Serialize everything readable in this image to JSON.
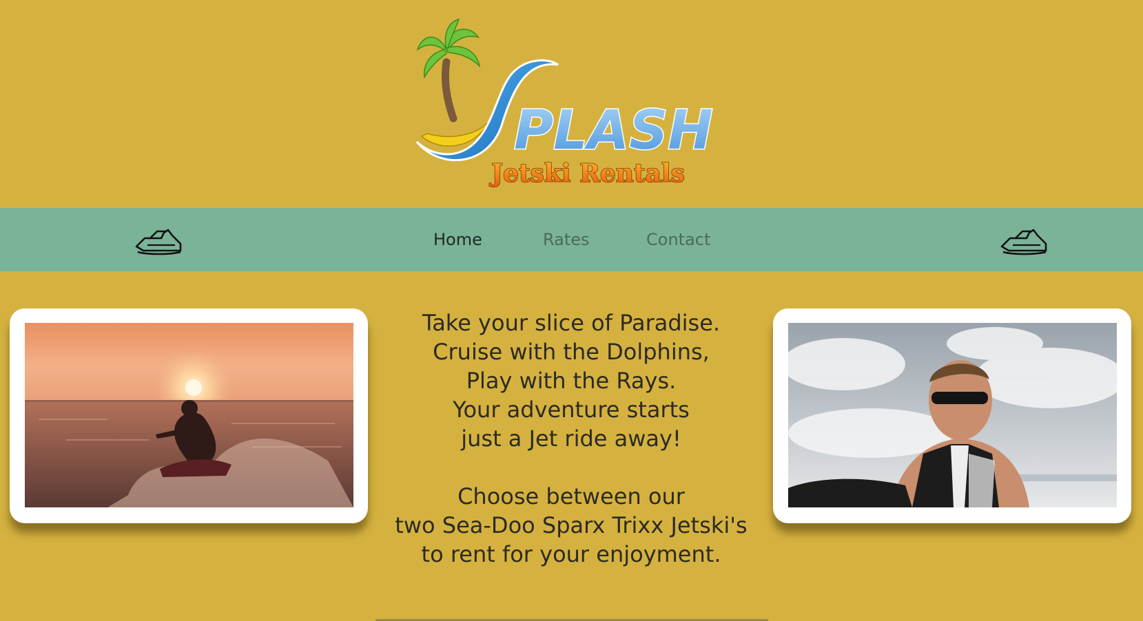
{
  "logo": {
    "brand": "SPLASH",
    "subtitle": "Jetski Rentals",
    "colors": {
      "wave": "#2f93d6",
      "letters": "#6fb2e8",
      "subtitle": "#f07b12",
      "palm_leaves": "#6cc43a",
      "banana": "#f3cf1c"
    }
  },
  "nav": {
    "left_icon": "jetski-icon",
    "right_icon": "jetski-icon",
    "items": [
      {
        "label": "Home",
        "active": true
      },
      {
        "label": "Rates",
        "active": false
      },
      {
        "label": "Contact",
        "active": false
      }
    ]
  },
  "hero": {
    "lines": [
      "Take your slice of Paradise.",
      "Cruise with the Dolphins,",
      "Play with the Rays.",
      "Your adventure starts",
      "just a Jet ride away!"
    ],
    "lines2": [
      "Choose between our",
      "two Sea-Doo Sparx Trixx Jetski's",
      "to rent for your enjoyment."
    ]
  },
  "photos": {
    "left": "sunset jetski rider photo",
    "right": "rider in sunglasses photo"
  },
  "colors": {
    "page_bg": "#d5b23f",
    "nav_bg": "#7bb399",
    "text": "#2c2a23"
  }
}
